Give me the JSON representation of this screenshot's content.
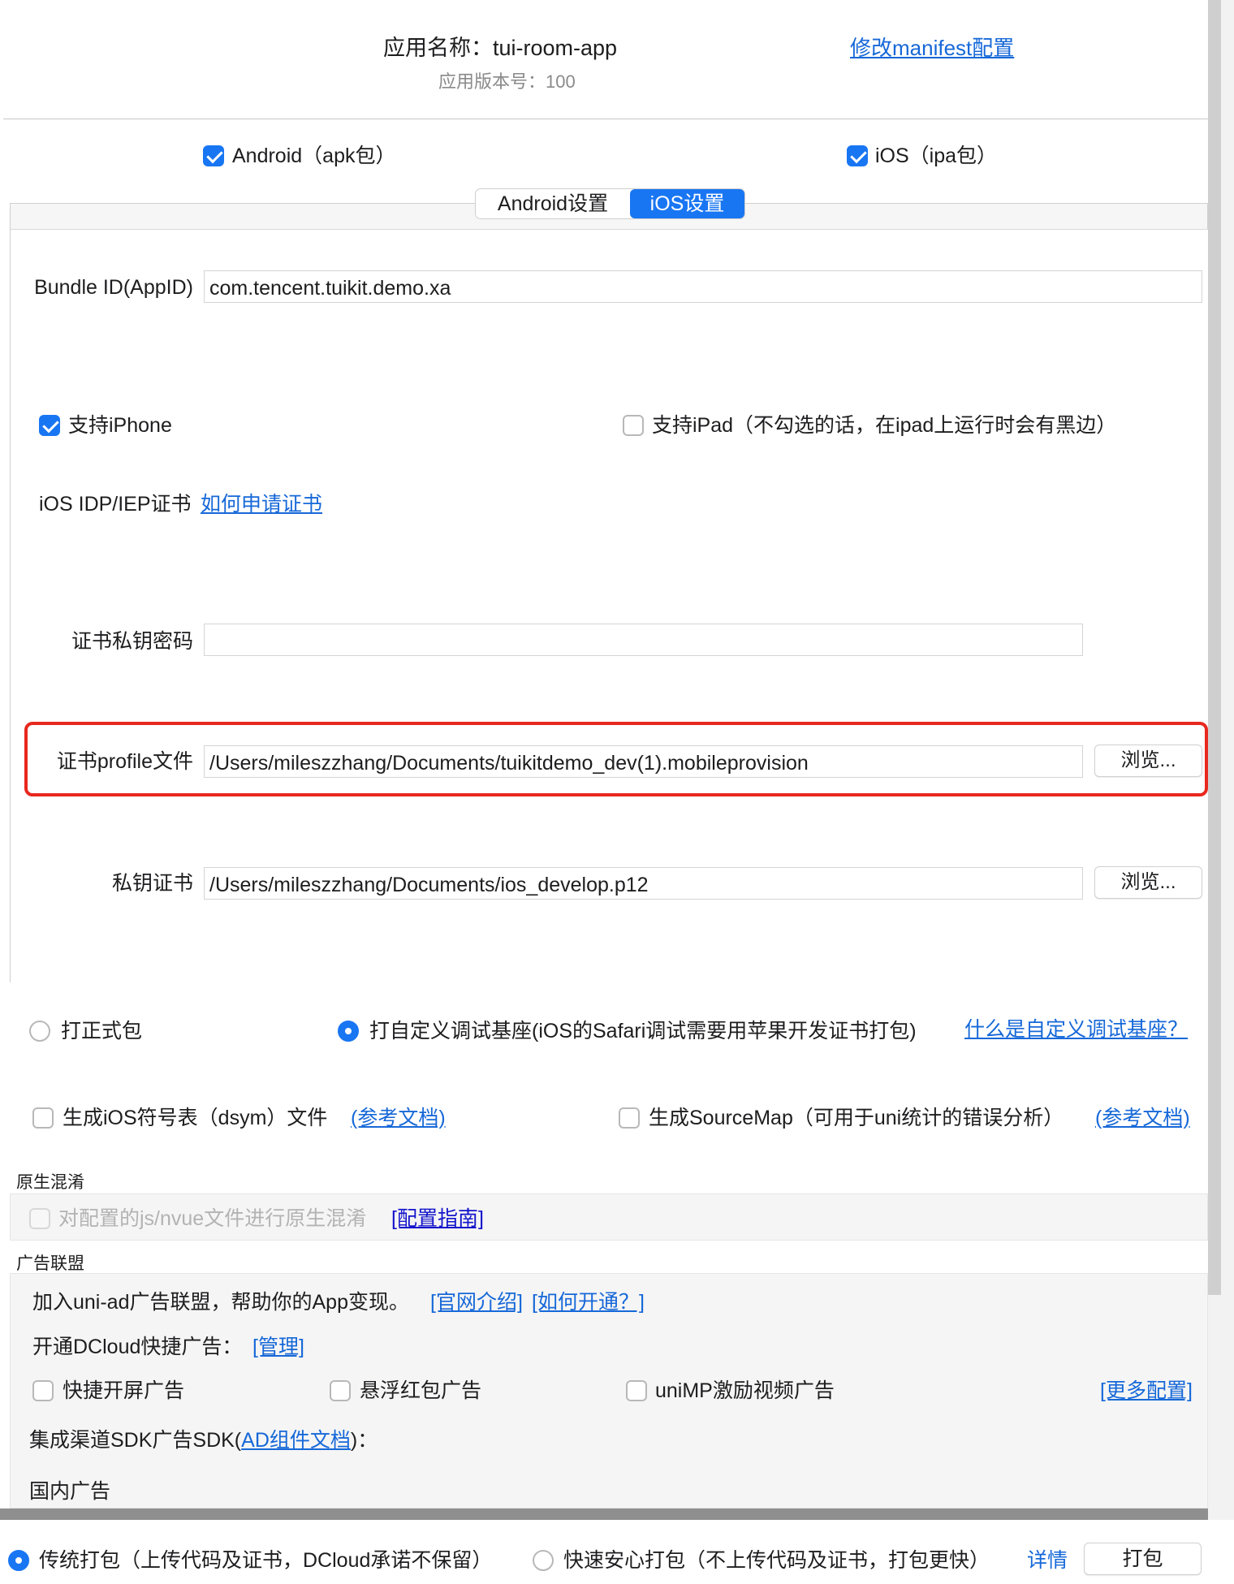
{
  "header": {
    "app_name": "应用名称：tui-room-app",
    "version": "应用版本号：100",
    "manifest_link": "修改manifest配置"
  },
  "platforms": {
    "android": {
      "label": "Android（apk包）",
      "checked": true
    },
    "ios": {
      "label": "iOS（ipa包）",
      "checked": true
    }
  },
  "tabs": [
    {
      "label": "Android设置",
      "active": false
    },
    {
      "label": "iOS设置",
      "active": true
    }
  ],
  "ios_settings": {
    "bundle_id_label": "Bundle ID(AppID)",
    "bundle_id_value": "com.tencent.tuikit.demo.xa",
    "support_iphone": "支持iPhone",
    "support_ipad": "支持iPad（不勾选的话，在ipad上运行时会有黑边）",
    "cert_type_label": "iOS IDP/IEP证书",
    "cert_howto_link": "如何申请证书",
    "cert_password_label": "证书私钥密码",
    "cert_password_value": "",
    "profile_label": "证书profile文件",
    "profile_value": "/Users/mileszzhang/Documents/tuikitdemo_dev(1).mobileprovision",
    "private_key_label": "私钥证书",
    "private_key_value": "/Users/mileszzhang/Documents/ios_develop.p12",
    "browse_label": "浏览..."
  },
  "build_type": {
    "release": "打正式包",
    "custom_base": "打自定义调试基座(iOS的Safari调试需要用苹果开发证书打包)",
    "what_is_link": "什么是自定义调试基座？"
  },
  "options": {
    "dsym": "生成iOS符号表（dsym）文件",
    "dsym_doc": "(参考文档)",
    "sourcemap": "生成SourceMap（可用于uni统计的错误分析）",
    "sourcemap_doc": "(参考文档)"
  },
  "obfuscation": {
    "section_title": "原生混淆",
    "checkbox": "对配置的js/nvue文件进行原生混淆",
    "guide_link": "[配置指南]"
  },
  "ads": {
    "section_title": "广告联盟",
    "join_text": "加入uni-ad广告联盟，帮助你的App变现。",
    "official_link": "[官网介绍]",
    "howto_link": "[如何开通？]",
    "dcloud_text": "开通DCloud快捷广告：",
    "manage_link": "[管理]",
    "splash": "快捷开屏广告",
    "floating": "悬浮红包广告",
    "video": "uniMP激励视频广告",
    "more_link": "[更多配置]",
    "sdk_prefix": "集成渠道SDK广告SDK(",
    "sdk_link": "AD组件文档",
    "sdk_suffix": ")：",
    "domestic": "国内广告"
  },
  "footer": {
    "traditional": "传统打包（上传代码及证书，DCloud承诺不保留）",
    "fast": "快速安心打包（不上传代码及证书，打包更快）",
    "details_link": "详情",
    "pack_button": "打包"
  },
  "colors": {
    "accent": "#1976f3",
    "link": "#1668d8",
    "highlight": "#e8281e"
  }
}
